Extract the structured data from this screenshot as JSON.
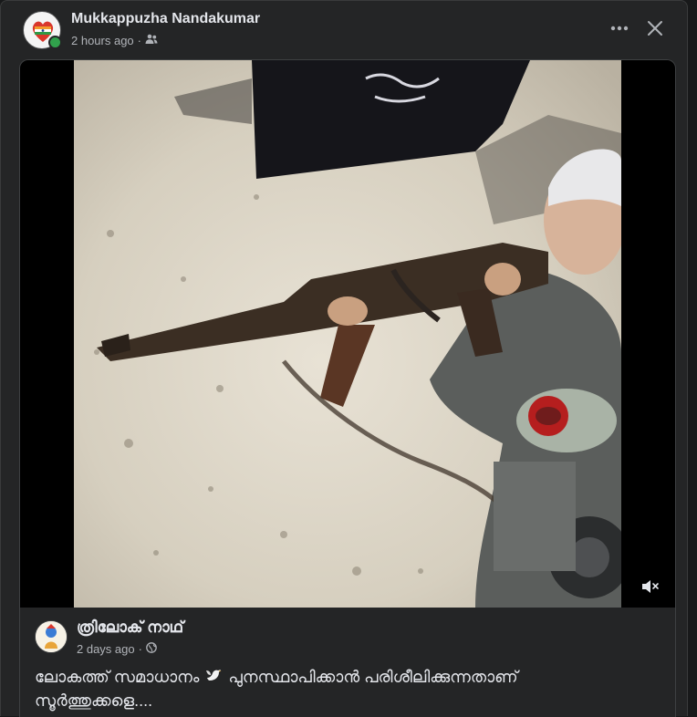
{
  "post": {
    "author": "Mukkappuzha Nandakumar",
    "time": "2 hours ago",
    "separator": "·",
    "audience_icon": "friends-icon"
  },
  "actions": {
    "more_icon": "more-options-icon",
    "close_icon": "close-icon"
  },
  "shared_post": {
    "author": "ത്രിലോക് നാഥ്",
    "time": "2 days ago",
    "separator": "·",
    "audience_icon": "globe-icon",
    "text_part1": "ലോകത്ത് സമാധാനം",
    "emoji_icon": "dove-icon",
    "text_part2": "പുനസ്ഥാപിക്കാൻ  പരിശീലിക്കുന്നതാണ് സൂർത്തുക്കളെ...."
  },
  "video": {
    "mute_icon": "muted-speaker-icon",
    "muted": true
  },
  "colors": {
    "background": "#242526",
    "text_primary": "#e4e6eb",
    "text_secondary": "#b0b3b8",
    "online": "#31a24c"
  }
}
